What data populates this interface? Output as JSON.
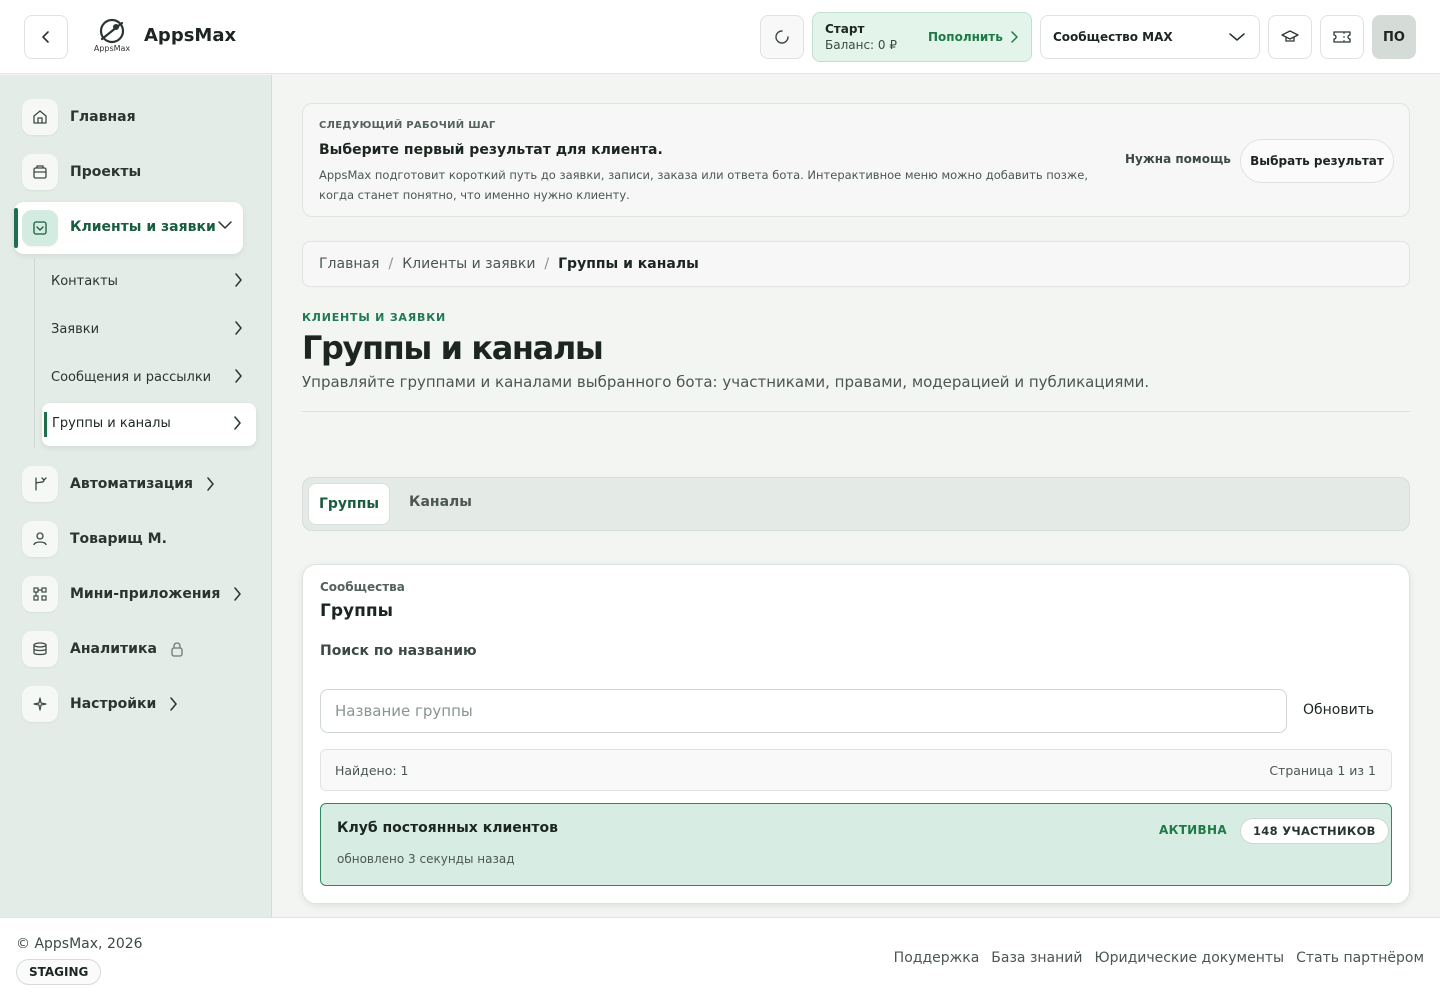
{
  "header": {
    "brand": "AppsMax",
    "logo_caption": "AppsMax",
    "balance_plan": "Старт",
    "balance_amount": "Баланс: 0 ₽",
    "topup_label": "Пополнить",
    "community_label": "Сообщество MAX",
    "avatar_initials": "ПО"
  },
  "sidebar": {
    "items": [
      {
        "label": "Главная",
        "icon": "home-icon"
      },
      {
        "label": "Проекты",
        "icon": "folder-icon"
      },
      {
        "label": "Клиенты и заявки",
        "icon": "inbox-icon"
      },
      {
        "label": "Автоматизация",
        "icon": "flow-icon"
      },
      {
        "label": "Товарищ М.",
        "icon": "user-icon"
      },
      {
        "label": "Мини-приложения",
        "icon": "apps-icon"
      },
      {
        "label": "Аналитика",
        "icon": "database-icon"
      },
      {
        "label": "Настройки",
        "icon": "sparkle-icon"
      }
    ],
    "subitems": [
      {
        "label": "Контакты"
      },
      {
        "label": "Заявки"
      },
      {
        "label": "Сообщения и рассылки"
      },
      {
        "label": "Группы и каналы"
      }
    ]
  },
  "next_step": {
    "overline": "СЛЕДУЮЩИЙ РАБОЧИЙ ШАГ",
    "title": "Выберите первый результат для клиента.",
    "description": "AppsMax подготовит короткий путь до заявки, записи, заказа или ответа бота. Интерактивное меню можно добавить позже, когда станет понятно, что именно нужно клиенту.",
    "help_label": "Нужна помощь",
    "choose_label": "Выбрать результат"
  },
  "breadcrumb": {
    "items": [
      "Главная",
      "Клиенты и заявки"
    ],
    "current": "Группы и каналы"
  },
  "page": {
    "overline": "КЛИЕНТЫ И ЗАЯВКИ",
    "title": "Группы и каналы",
    "description": "Управляйте группами и каналами выбранного бота: участниками, правами, модерацией и публикациями."
  },
  "tabs": [
    {
      "label": "Группы",
      "active": true
    },
    {
      "label": "Каналы",
      "active": false
    }
  ],
  "groups_panel": {
    "kicker": "Сообщества",
    "title": "Группы",
    "search_label": "Поиск по названию",
    "search_placeholder": "Название группы",
    "search_value": "",
    "refresh_label": "Обновить",
    "found_text": "Найдено: 1",
    "page_text": "Страница 1 из 1",
    "rows": [
      {
        "name": "Клуб постоянных клиентов",
        "updated": "обновлено 3 секунды назад",
        "status": "АКТИВНА",
        "members": "148 УЧАСТНИКОВ"
      }
    ]
  },
  "footer": {
    "copyright": "© AppsMax, 2026",
    "env_badge": "STAGING",
    "links": [
      "Поддержка",
      "База знаний",
      "Юридические документы",
      "Стать партнёром"
    ]
  },
  "colors": {
    "accent": "#1f6f4f",
    "accent_light": "#d7ede3",
    "balance_bg": "#e3f5ea",
    "status_green": "#1f7a45"
  }
}
